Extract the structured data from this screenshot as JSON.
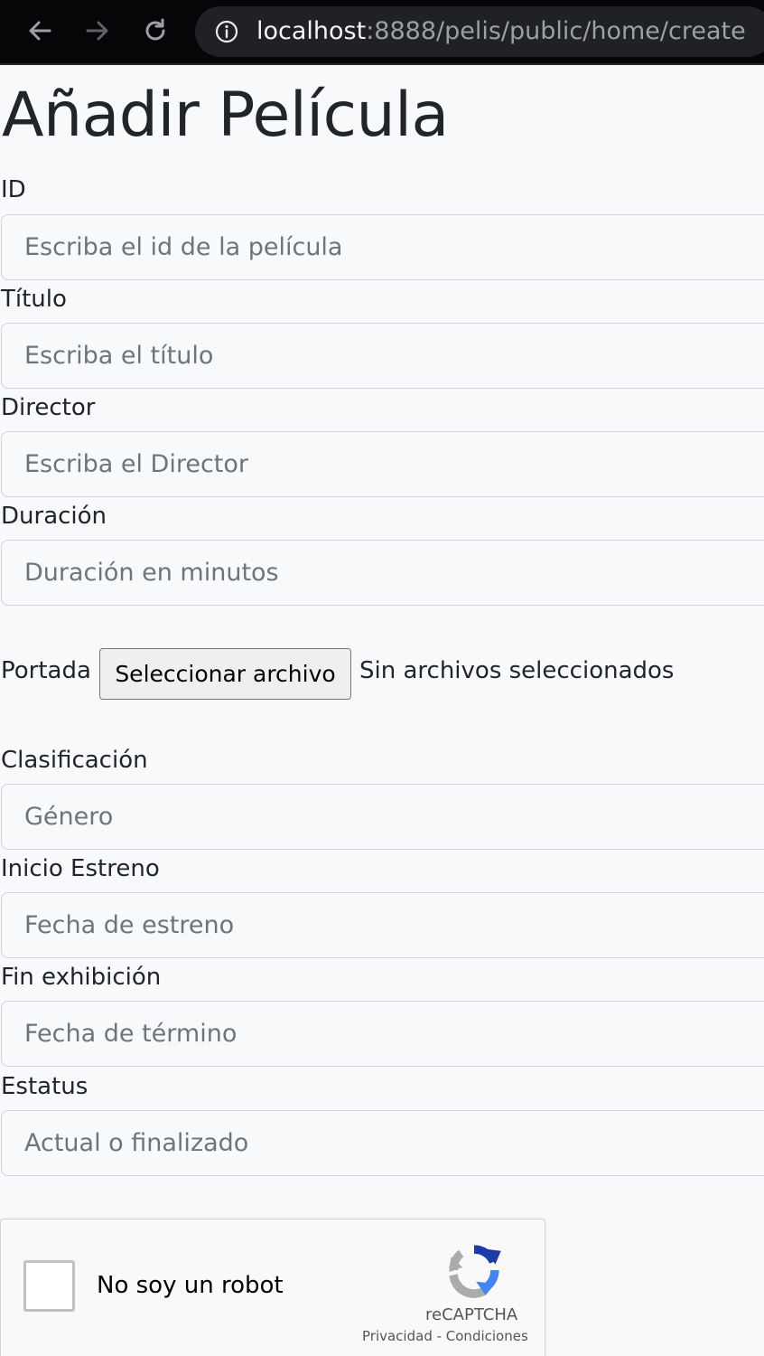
{
  "browser": {
    "url_host": "localhost",
    "url_path": ":8888/pelis/public/home/create"
  },
  "page": {
    "title": "Añadir Película"
  },
  "form": {
    "id_label": "ID",
    "id_placeholder": "Escriba el id de la película",
    "titulo_label": "Título",
    "titulo_placeholder": "Escriba el título",
    "director_label": "Director",
    "director_placeholder": "Escriba el Director",
    "duracion_label": "Duración",
    "duracion_placeholder": "Duración en minutos",
    "portada_label": "Portada",
    "portada_button": "Seleccionar archivo",
    "portada_status": "Sin archivos seleccionados",
    "clasificacion_label": "Clasificación",
    "clasificacion_placeholder": "Género",
    "inicio_label": "Inicio Estreno",
    "inicio_placeholder": "Fecha de estreno",
    "fin_label": "Fin exhibición",
    "fin_placeholder": "Fecha de término",
    "estatus_label": "Estatus",
    "estatus_placeholder": "Actual o finalizado"
  },
  "captcha": {
    "label": "No soy un robot",
    "brand": "reCAPTCHA",
    "links": "Privacidad - Condiciones"
  }
}
